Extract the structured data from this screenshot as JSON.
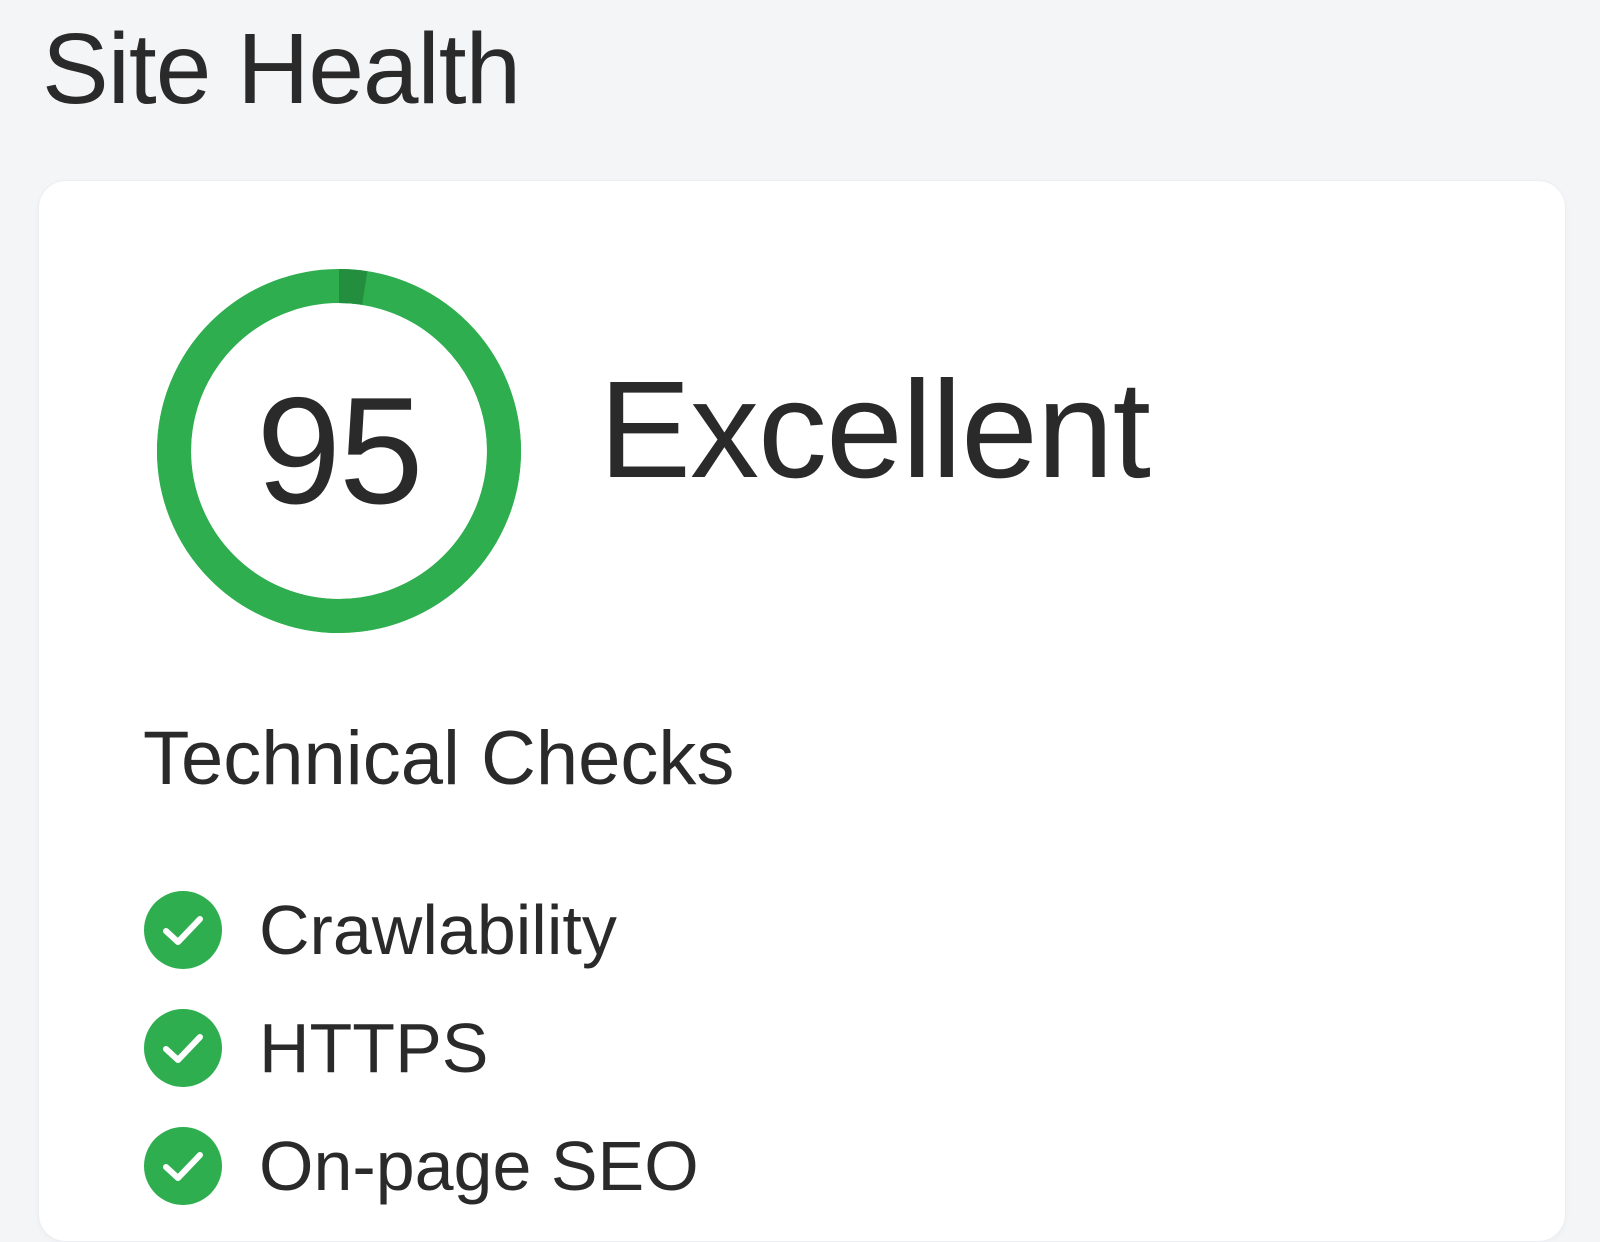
{
  "page": {
    "title": "Site Health"
  },
  "score": {
    "value": "95",
    "percent": 95,
    "rating": "Excellent",
    "ring_color": "#2eae4e",
    "ring_start_color": "#238f3e"
  },
  "technical_checks": {
    "heading": "Technical Checks",
    "items": [
      {
        "label": "Crawlability",
        "status": "passed",
        "icon": "check-circle-icon"
      },
      {
        "label": "HTTPS",
        "status": "passed",
        "icon": "check-circle-icon"
      },
      {
        "label": "On-page SEO",
        "status": "passed",
        "icon": "check-circle-icon"
      }
    ]
  },
  "colors": {
    "success": "#2eae4e",
    "text": "#2a2a2a",
    "background": "#f4f5f7",
    "card": "#ffffff"
  }
}
